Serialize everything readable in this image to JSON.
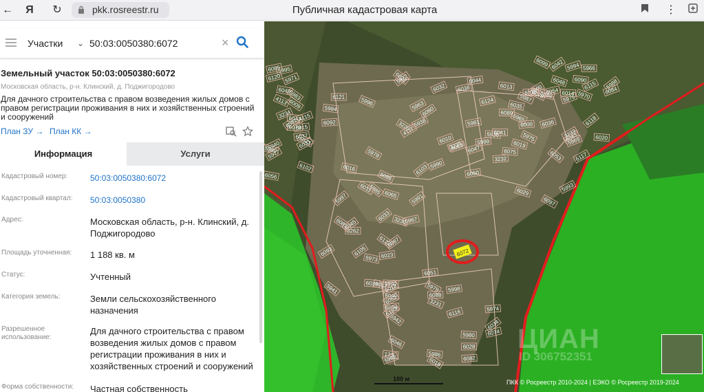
{
  "browser": {
    "url": "pkk.rosreestr.ru",
    "title": "Публичная кадастровая карта"
  },
  "search": {
    "type_label": "Участки",
    "query": "50:03:0050380:6072"
  },
  "parcel": {
    "title": "Земельный участок 50:03:0050380:6072",
    "address_short": "Московская область, р-н. Клинский, д. Поджигородово",
    "description": "Для дачного строительства с правом возведения жилых домов с правом регистрации проживания в них и хозяйственных строений и сооружений",
    "plan_zu": "План ЗУ →",
    "plan_kk": "План КК →"
  },
  "tabs": {
    "info": "Информация",
    "services": "Услуги"
  },
  "info_rows": [
    {
      "label": "Кадастровый номер:",
      "value": "50:03:0050380:6072"
    },
    {
      "label": "Кадастровый квартал:",
      "value": "50:03:0050380"
    },
    {
      "label": "Адрес:",
      "value": "Московская область, р-н. Клинский, д. Поджигородово"
    },
    {
      "label": "Площадь уточненная:",
      "value": "1 188 кв. м"
    },
    {
      "label": "Статус:",
      "value": "Учтенный"
    },
    {
      "label": "Категория земель:",
      "value": "Земли сельскохозяйственного назначения"
    },
    {
      "label": "Разрешенное использование:",
      "value": "Для дачного строительства с правом возведения жилых домов с правом регистрации проживания в них и хозяйственных строений и сооружений"
    },
    {
      "label": "Форма собственности:",
      "value": "Частная собственность"
    }
  ],
  "map": {
    "scale": "100 м",
    "copyright": "ПКК © Росреестр 2010-2024 | ЕЭКО © Росреестр 2019-2024",
    "watermark": "ЦИАН",
    "watermark_id": "ID 306752351",
    "highlight_lot": "6072",
    "lots": [
      "4111",
      "3262",
      "123",
      "5965",
      "5966",
      "5940",
      "5938",
      "5941",
      "5942",
      "5936",
      "6115",
      "4115",
      "5963",
      "5967",
      "5968",
      "5969",
      "5970",
      "5971",
      "5972",
      "5973",
      "5974",
      "5975",
      "5976",
      "5977",
      "5978",
      "5979",
      "5980",
      "5981",
      "5982",
      "5983",
      "5984",
      "5985",
      "5986",
      "5987",
      "5988",
      "5989",
      "5990",
      "5991",
      "5992",
      "5993",
      "5994",
      "5995",
      "5996",
      "5997",
      "5998",
      "5999",
      "6000",
      "6009",
      "6010",
      "6011",
      "6012",
      "6013",
      "6014",
      "6015",
      "6016",
      "6017",
      "6018",
      "6019",
      "6020",
      "6021",
      "6022",
      "6023",
      "6028",
      "6029",
      "6030",
      "6031",
      "6032",
      "6033",
      "6034",
      "6035",
      "6036",
      "6037",
      "6038",
      "6039",
      "6040",
      "6041",
      "6042",
      "6043",
      "6044",
      "6045",
      "6046",
      "6047",
      "6048",
      "6049",
      "6050",
      "6051",
      "6052",
      "6053",
      "6054",
      "6056",
      "6063",
      "6065",
      "6074",
      "6075",
      "6078",
      "6079",
      "6080",
      "6081",
      "6082",
      "6083",
      "6084",
      "6085",
      "6086",
      "6087",
      "6088",
      "6089",
      "6090",
      "6091",
      "6092",
      "6093",
      "6094",
      "6097",
      "6099",
      "6102",
      "6103",
      "6105",
      "6116",
      "6117",
      "6118",
      "6120",
      "6121",
      "6122",
      "6123",
      "6124",
      "7500",
      "4113",
      "3220",
      "3230",
      "3231",
      "3232",
      "3233",
      "3234",
      "3235"
    ],
    "accent_color": "#e11d1d",
    "highlight_color": "#f3f01a"
  }
}
